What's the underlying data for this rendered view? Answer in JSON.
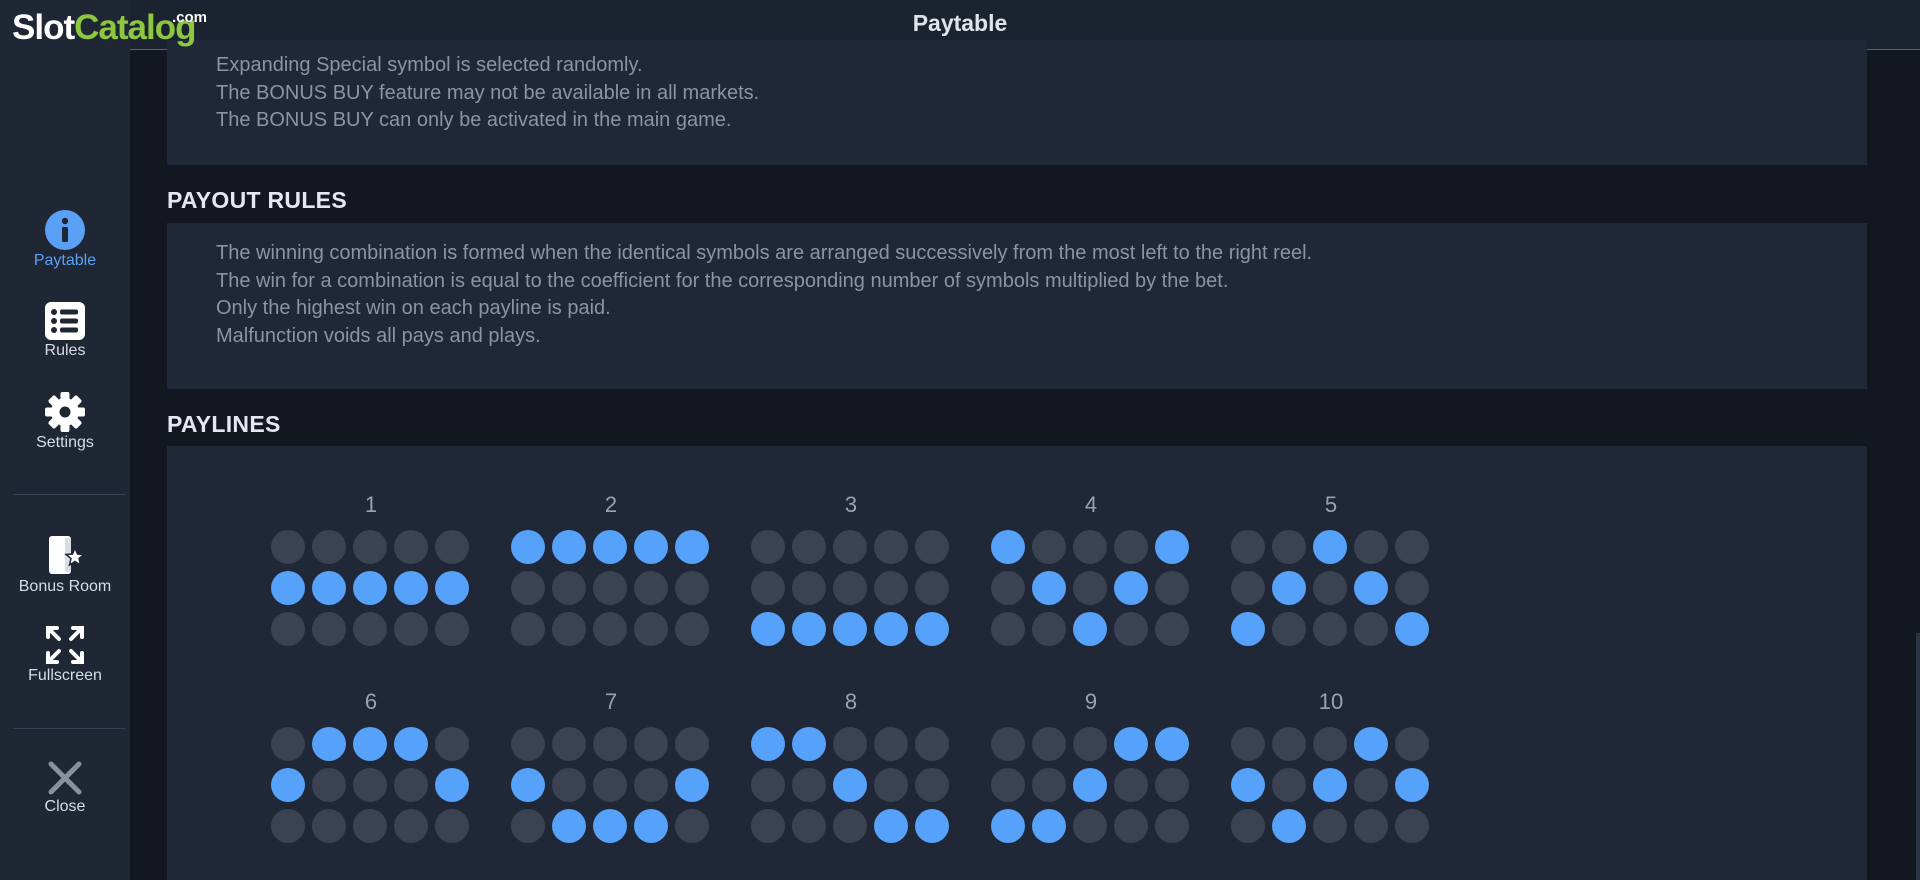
{
  "header": {
    "title": "Paytable"
  },
  "logo": {
    "part1": "Slot",
    "part2": "Catalog",
    "tld": ".com"
  },
  "sidebar": {
    "items": [
      {
        "label": "Paytable",
        "icon": "info-icon",
        "active": true
      },
      {
        "label": "Rules",
        "icon": "list-icon"
      },
      {
        "label": "Settings",
        "icon": "gear-icon"
      },
      {
        "label": "Bonus Room",
        "icon": "door-star-icon"
      },
      {
        "label": "Fullscreen",
        "icon": "fullscreen-icon"
      },
      {
        "label": "Close",
        "icon": "close-icon"
      }
    ]
  },
  "bonus_panel": {
    "lines": [
      "Expanding Special symbol is selected randomly.",
      "The BONUS BUY feature may not be available in all markets.",
      "The BONUS BUY can only be activated in the main game."
    ]
  },
  "payout_rules": {
    "heading": "PAYOUT RULES",
    "lines": [
      "The winning combination is formed when the identical symbols are arranged successively from the most left to the right reel.",
      "The win for a combination is equal to the coefficient for the corresponding number of symbols multiplied by the bet.",
      "Only the highest win on each payline is paid.",
      "Malfunction voids all pays and plays."
    ]
  },
  "paylines": {
    "heading": "PAYLINES",
    "lines": [
      {
        "number": "1",
        "rows": [
          1,
          1,
          1,
          1,
          1
        ]
      },
      {
        "number": "2",
        "rows": [
          0,
          0,
          0,
          0,
          0
        ]
      },
      {
        "number": "3",
        "rows": [
          2,
          2,
          2,
          2,
          2
        ]
      },
      {
        "number": "4",
        "rows": [
          0,
          1,
          2,
          1,
          0
        ]
      },
      {
        "number": "5",
        "rows": [
          2,
          1,
          0,
          1,
          2
        ]
      },
      {
        "number": "6",
        "rows": [
          1,
          0,
          0,
          0,
          1
        ]
      },
      {
        "number": "7",
        "rows": [
          1,
          2,
          2,
          2,
          1
        ]
      },
      {
        "number": "8",
        "rows": [
          0,
          0,
          1,
          2,
          2
        ]
      },
      {
        "number": "9",
        "rows": [
          2,
          2,
          1,
          0,
          0
        ]
      },
      {
        "number": "10",
        "rows": [
          1,
          2,
          1,
          0,
          1
        ]
      }
    ]
  },
  "colors": {
    "active_dot": "#56a1fa",
    "inactive_dot": "#3b4352",
    "accent": "#5aa0f5"
  }
}
